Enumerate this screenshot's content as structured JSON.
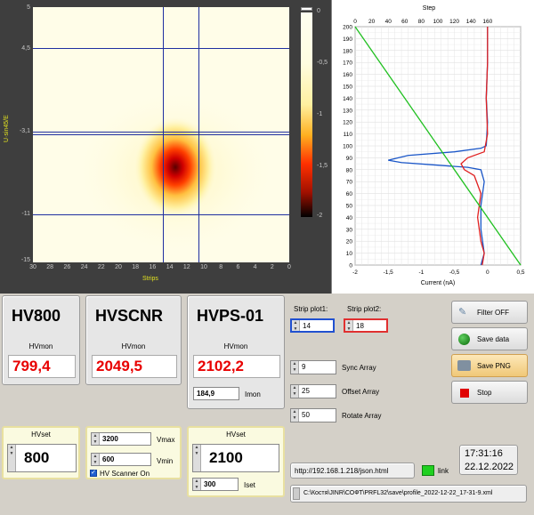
{
  "heatmap": {
    "y_label": "U·sin45/E",
    "x_label": "Strips",
    "y_ticks": [
      "5",
      "4,5",
      "-3,1",
      "-11",
      "-15"
    ],
    "x_ticks": [
      "30",
      "28",
      "26",
      "24",
      "22",
      "20",
      "18",
      "16",
      "14",
      "12",
      "10",
      "8",
      "6",
      "4",
      "2",
      "0"
    ],
    "colorbar_ticks": [
      "0",
      "-0,5",
      "-1",
      "-1,5",
      "-2"
    ]
  },
  "chart_data": {
    "type": "line",
    "title": "Step",
    "xlabel": "Current (nA)",
    "ylabel": "",
    "x_bottom_ticks": [
      "-2",
      "-1,5",
      "-1",
      "-0,5",
      "0",
      "0,5"
    ],
    "x_top_ticks": [
      "0",
      "20",
      "40",
      "60",
      "80",
      "100",
      "120",
      "140",
      "160"
    ],
    "y_ticks": [
      "200",
      "190",
      "180",
      "170",
      "160",
      "150",
      "140",
      "130",
      "120",
      "110",
      "100",
      "90",
      "80",
      "70",
      "60",
      "50",
      "40",
      "30",
      "20",
      "10",
      "0"
    ],
    "xlim": [
      -2,
      0.5
    ],
    "ylim": [
      0,
      200
    ],
    "series": [
      {
        "color": "#1a56c8",
        "x": [
          0,
          0,
          -0.02,
          0,
          -0.02,
          -0.1,
          -0.5,
          -1.2,
          -1.5,
          -1.3,
          -0.8,
          -0.3,
          -0.1,
          -0.05,
          -0.1,
          -0.1,
          -0.05,
          -0.1
        ],
        "y": [
          200,
          170,
          140,
          120,
          100,
          98,
          95,
          92,
          88,
          86,
          84,
          82,
          80,
          70,
          50,
          30,
          10,
          0
        ]
      },
      {
        "color": "#e02020",
        "x": [
          0,
          0,
          -0.02,
          0,
          -0.05,
          -0.3,
          -0.4,
          -0.35,
          -0.2,
          -0.1,
          -0.15,
          -0.1,
          -0.05,
          -0.08
        ],
        "y": [
          200,
          170,
          140,
          110,
          95,
          90,
          85,
          80,
          75,
          60,
          40,
          20,
          10,
          0
        ]
      },
      {
        "color": "#20c020",
        "x": [
          -2,
          0.5
        ],
        "y": [
          200,
          0
        ]
      }
    ]
  },
  "devices": [
    {
      "name": "HV800",
      "mon_label": "HVmon",
      "mon_value": "799,4"
    },
    {
      "name": "HVSCNR",
      "mon_label": "HVmon",
      "mon_value": "2049,5"
    },
    {
      "name": "HVPS-01",
      "mon_label": "HVmon",
      "mon_value": "2102,2",
      "imon_value": "184,9",
      "imon_label": "Imon"
    }
  ],
  "hvset1": {
    "label": "HVset",
    "value": "800"
  },
  "scanner": {
    "vmax": "3200",
    "vmax_label": "Vmax",
    "vmin": "600",
    "vmin_label": "Vmin",
    "checkbox_label": "HV Scanner On"
  },
  "hvset3": {
    "label": "HVset",
    "value": "2100",
    "iset": "300",
    "iset_label": "Iset"
  },
  "strip": {
    "plot1_label": "Strip plot1:",
    "plot1_value": "14",
    "plot2_label": "Strip plot2:",
    "plot2_value": "18"
  },
  "arrays": [
    {
      "value": "9",
      "label": "Sync Array"
    },
    {
      "value": "25",
      "label": "Offset Array"
    },
    {
      "value": "50",
      "label": "Rotate Array"
    }
  ],
  "buttons": {
    "filter": "Filter OFF",
    "save_data": "Save data",
    "save_png": "Save PNG",
    "stop": "Stop"
  },
  "clock": {
    "time": "17:31:16",
    "date": "22.12.2022"
  },
  "url": "http://192.168.1.218/json.html",
  "link_label": "link",
  "path": "C:\\Костя\\JINR\\СОФТ\\PRFL32\\save\\profile_2022-12-22_17-31-9.xml"
}
